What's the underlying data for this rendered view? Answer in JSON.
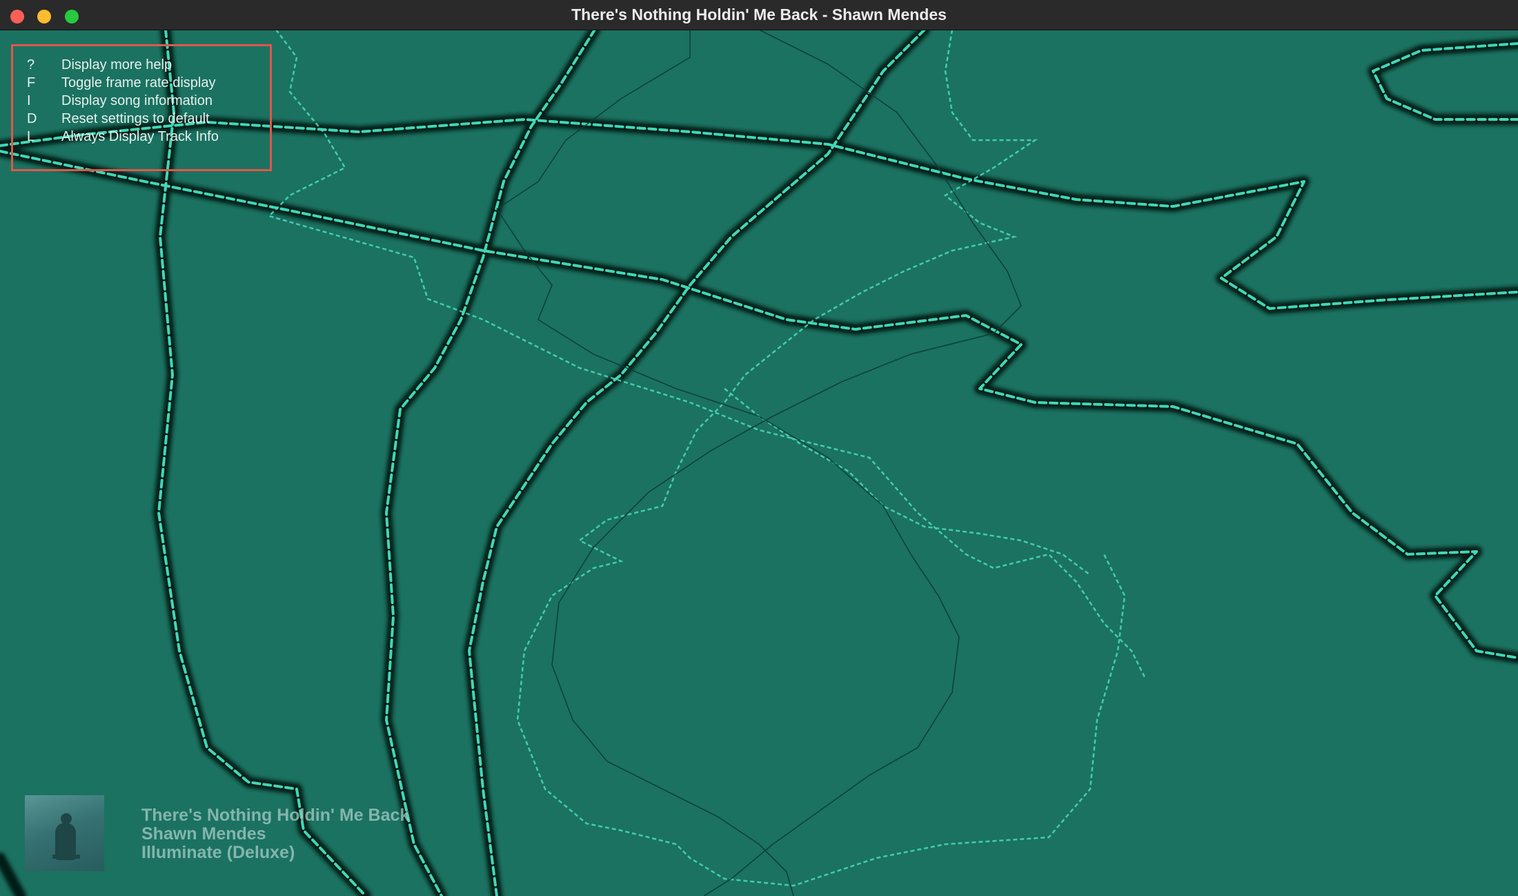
{
  "window": {
    "title": "There's Nothing Holdin' Me Back - Shawn Mendes",
    "background_color": "#1b7261",
    "traffic_lights": [
      "close",
      "minimize",
      "zoom"
    ]
  },
  "help": {
    "highlight_color": "#e0574c",
    "items": [
      {
        "key": "?",
        "label": "Display more help"
      },
      {
        "key": "F",
        "label": "Toggle frame rate display"
      },
      {
        "key": "I",
        "label": "Display song information"
      },
      {
        "key": "D",
        "label": "Reset settings to default"
      },
      {
        "key": "L",
        "label": "Always Display Track Info"
      }
    ]
  },
  "track": {
    "title": "There's Nothing Holdin' Me Back",
    "artist": "Shawn Mendes",
    "album": "Illuminate (Deluxe)",
    "art_icon": "album-art-image"
  },
  "visualizer": {
    "wave_color": "#3fd8b8",
    "shadow_color": "#041a15"
  }
}
